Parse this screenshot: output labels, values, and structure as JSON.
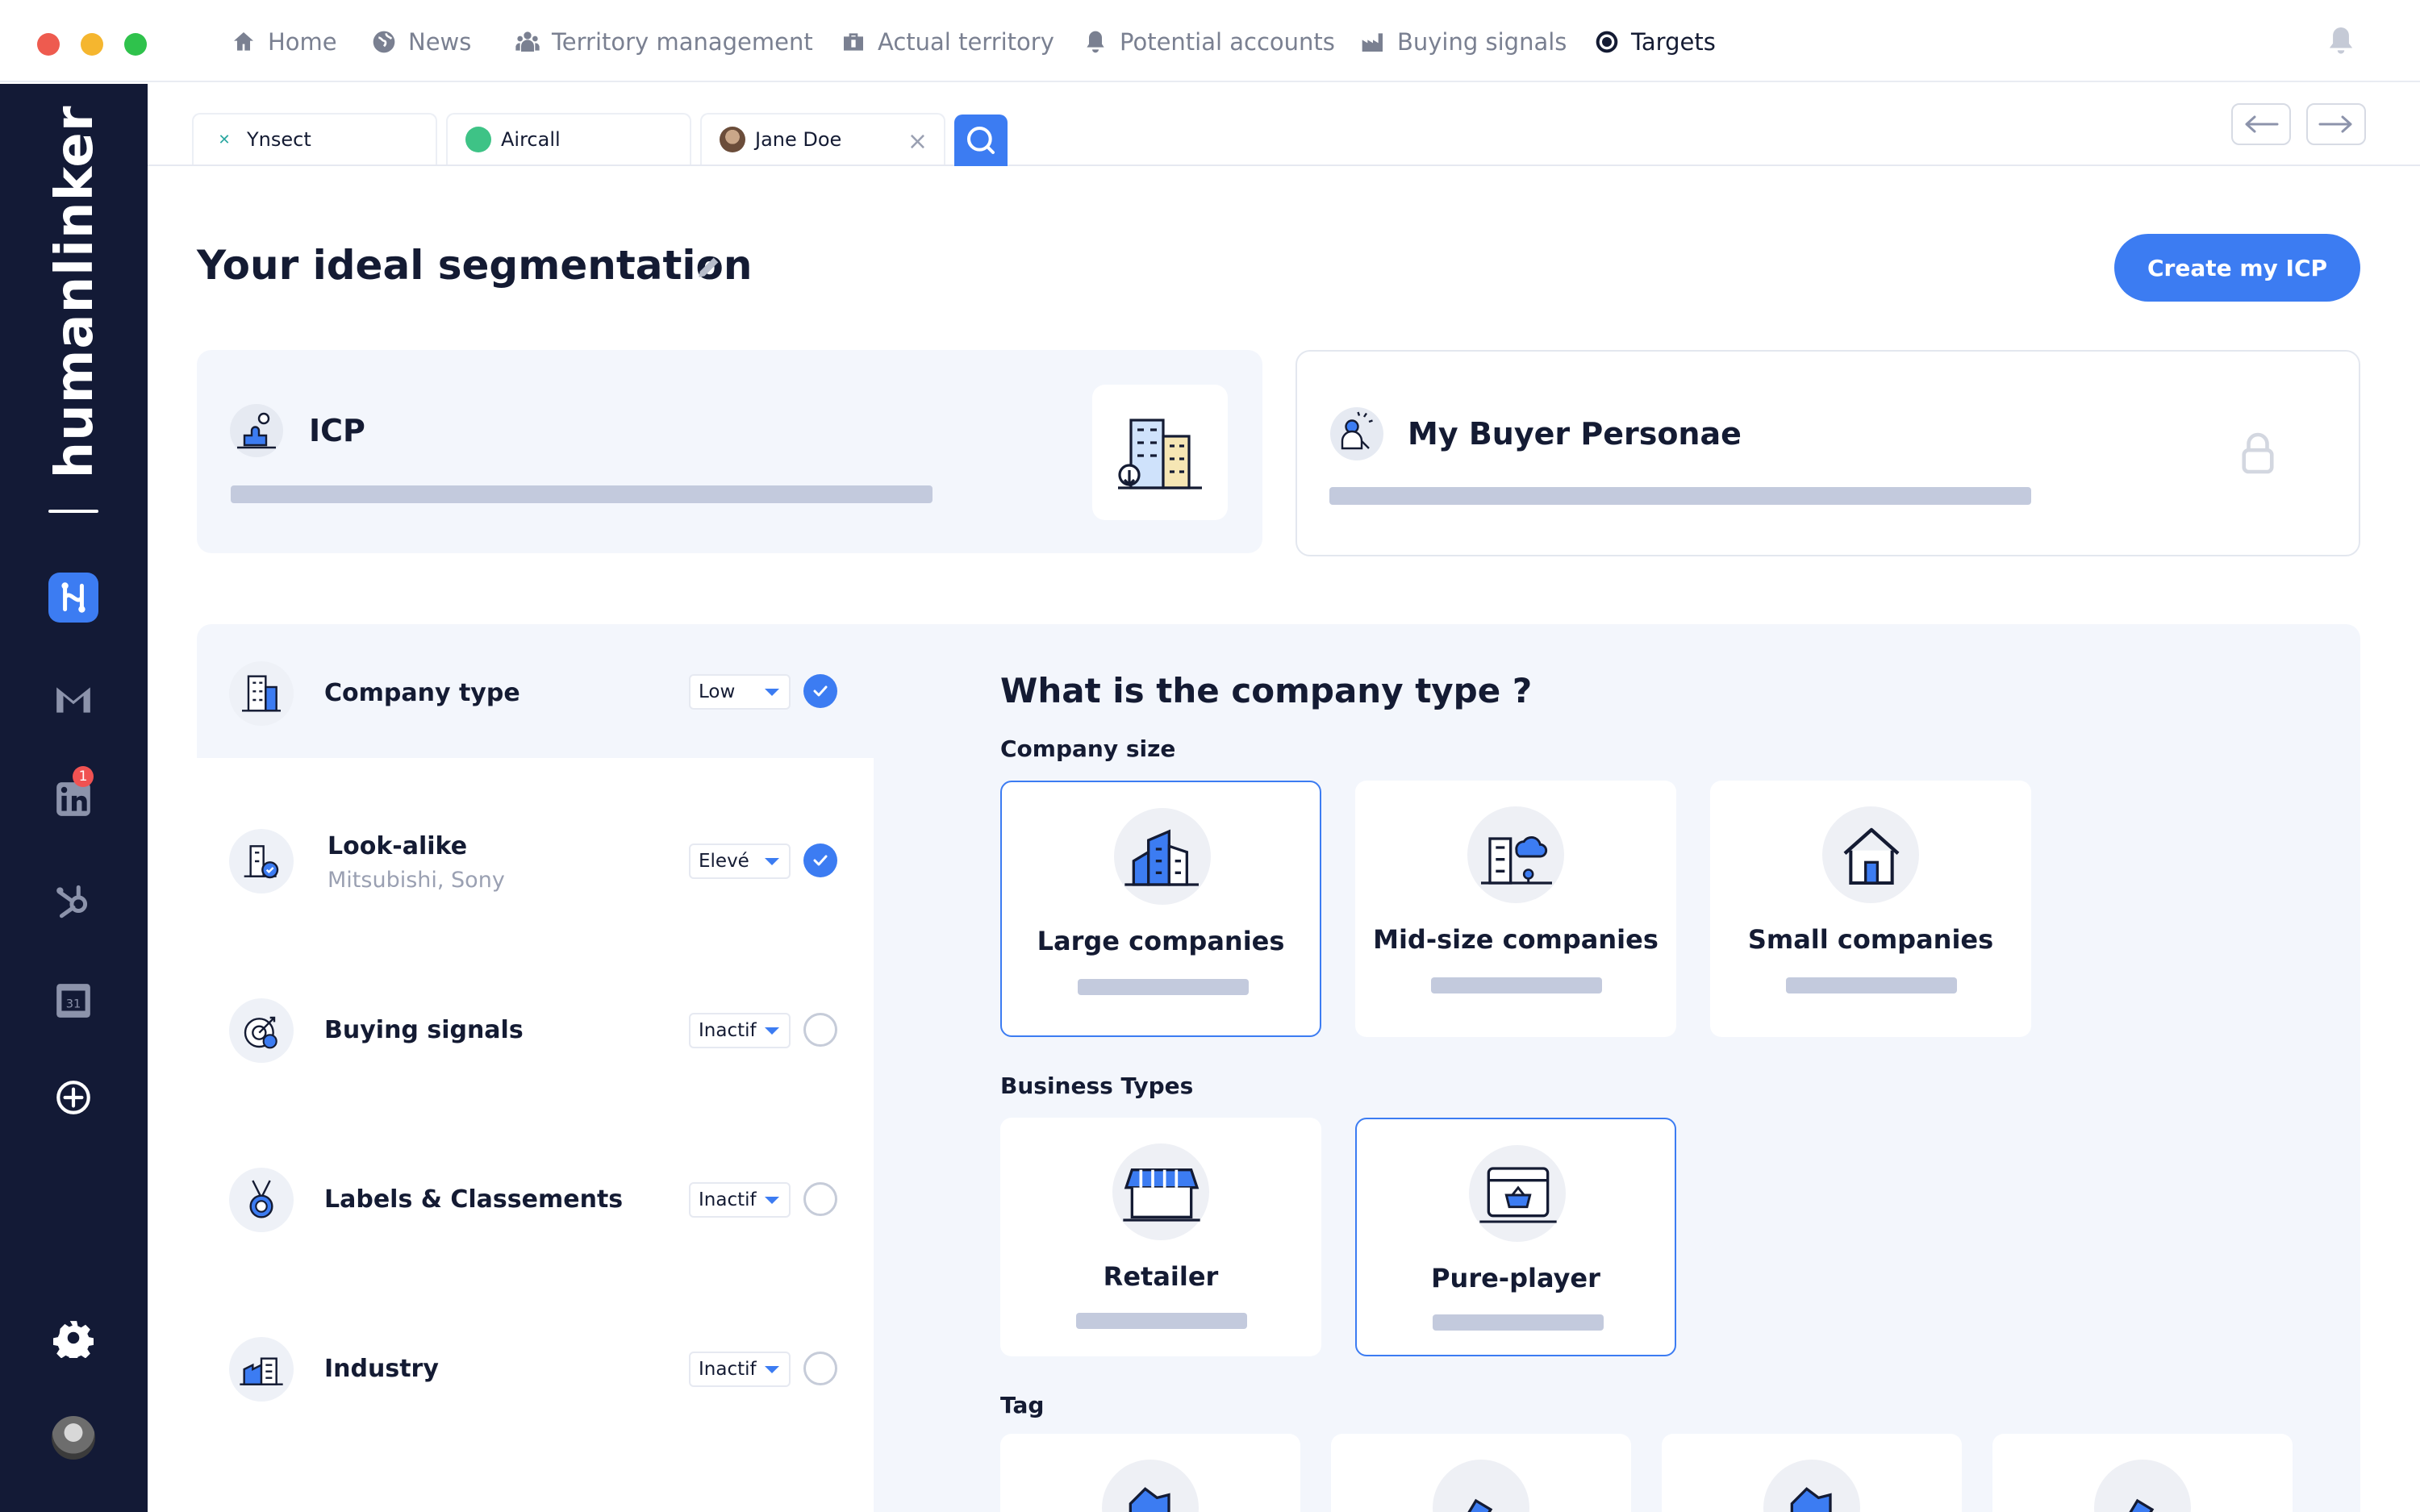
{
  "window": {
    "controls": {
      "close_color": "#ee5b4f",
      "minimize_color": "#f5b62f",
      "maximize_color": "#2fc24c"
    }
  },
  "top_nav": {
    "items": [
      {
        "label": "Home",
        "icon": "home-icon"
      },
      {
        "label": "News",
        "icon": "globe-icon"
      },
      {
        "label": "Territory management",
        "icon": "users-icon"
      },
      {
        "label": "Actual territory",
        "icon": "briefcase-icon"
      },
      {
        "label": "Potential accounts",
        "icon": "bell-icon"
      },
      {
        "label": "Buying signals",
        "icon": "factory-icon"
      },
      {
        "label": "Targets",
        "icon": "target-icon",
        "active": true
      }
    ],
    "notification_icon": "bell-icon"
  },
  "sidebar": {
    "brand": "humanlinker",
    "icons": [
      "humanlinker-app-icon",
      "gmail-icon",
      "linkedin-icon",
      "hubspot-icon",
      "calendar-icon",
      "add-circle-icon",
      "settings-icon",
      "user-avatar"
    ],
    "linkedin_badge": "1",
    "calendar_day": "31"
  },
  "tabs": {
    "items": [
      {
        "label": "Ynsect",
        "icon": "ynsect-logo"
      },
      {
        "label": "Aircall",
        "icon": "aircall-logo"
      },
      {
        "label": "Jane Doe",
        "icon": "avatar",
        "closable": true
      }
    ],
    "close_glyph": "×"
  },
  "header": {
    "title": "Your ideal segmentation",
    "create_button": "Create my ICP"
  },
  "cards": {
    "icp": {
      "title": "ICP"
    },
    "buyer_persona": {
      "title": "My Buyer Personae"
    }
  },
  "criteria": [
    {
      "label": "Company type",
      "sub": "",
      "level": "Low",
      "checked": true
    },
    {
      "label": "Look-alike",
      "sub": "Mitsubishi, Sony",
      "level": "Elevé",
      "checked": true
    },
    {
      "label": "Buying signals",
      "sub": "",
      "level": "Inactif",
      "checked": false
    },
    {
      "label": "Labels & Classements",
      "sub": "",
      "level": "Inactif",
      "checked": false
    },
    {
      "label": "Industry",
      "sub": "",
      "level": "Inactif",
      "checked": false
    }
  ],
  "question": {
    "title": "What is the company type ?",
    "company_size": {
      "label": "Company size",
      "options": [
        {
          "label": "Large companies",
          "selected": true
        },
        {
          "label": "Mid-size companies",
          "selected": false
        },
        {
          "label": "Small companies",
          "selected": false
        }
      ]
    },
    "business_types": {
      "label": "Business Types",
      "options": [
        {
          "label": "Retailer",
          "selected": false
        },
        {
          "label": "Pure-player",
          "selected": true
        }
      ]
    },
    "tag": {
      "label": "Tag"
    }
  },
  "colors": {
    "accent": "#3c7cf2",
    "sidebar_bg": "#131a36",
    "panel_bg": "#f3f6fc",
    "skeleton": "#c3cadd"
  }
}
